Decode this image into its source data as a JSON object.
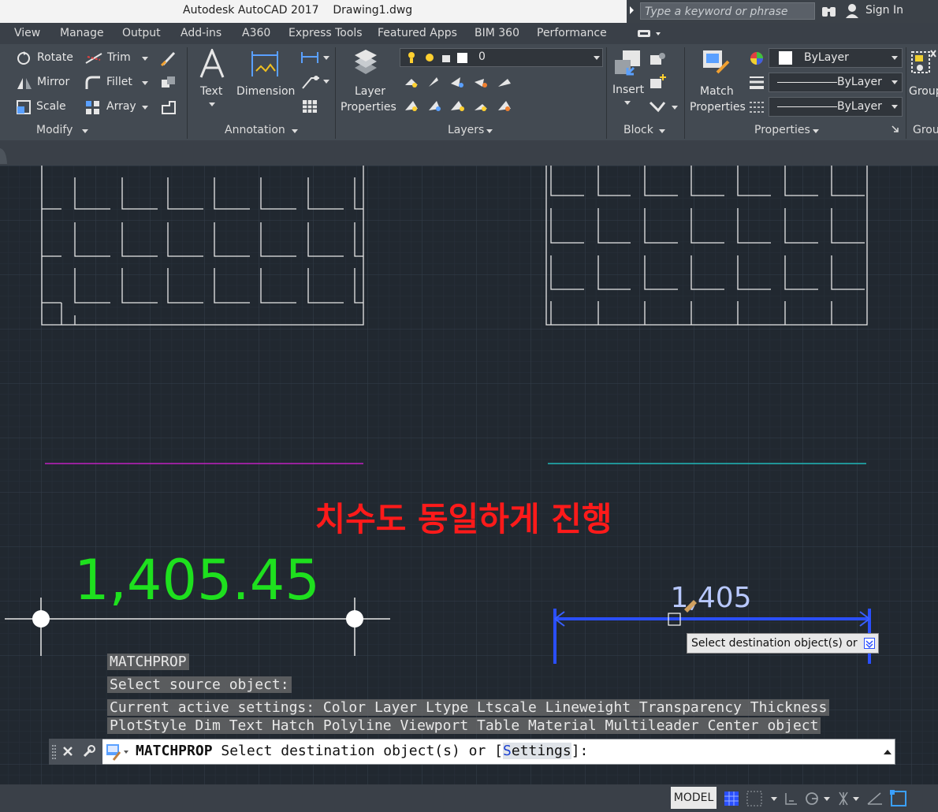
{
  "titlebar": {
    "title": "Autodesk AutoCAD 2017    Drawing1.dwg",
    "search_placeholder": "Type a keyword or phrase",
    "sign_in": "Sign In"
  },
  "menu_tabs": [
    "View",
    "Manage",
    "Output",
    "Add-ins",
    "A360",
    "Express Tools",
    "Featured Apps",
    "BIM 360",
    "Performance"
  ],
  "ribbon": {
    "modify": {
      "title": "Modify",
      "rotate": "Rotate",
      "mirror": "Mirror",
      "scale": "Scale",
      "trim": "Trim",
      "fillet": "Fillet",
      "array": "Array"
    },
    "annotation": {
      "title": "Annotation",
      "text": "Text",
      "dimension": "Dimension"
    },
    "layers": {
      "title": "Layers",
      "layer_properties_1": "Layer",
      "layer_properties_2": "Properties",
      "current_layer": "0"
    },
    "block": {
      "title": "Block",
      "insert": "Insert"
    },
    "properties": {
      "title": "Properties",
      "match_1": "Match",
      "match_2": "Properties",
      "color": "ByLayer",
      "linetype": "ByLayer",
      "lineweight": "ByLayer"
    },
    "groups": {
      "title": "Grou",
      "group": "Group"
    }
  },
  "canvas": {
    "annotation_korean": "치수도 동일하게 진행",
    "dim_left_value": "1,405.45",
    "dim_right_value": "1,405",
    "tooltip": "Select destination object(s) or",
    "colors": {
      "background": "#212830",
      "grid": "#2c3440",
      "magenta_line": "#c020c0",
      "cyan_line": "#20b8b8",
      "annotation_red": "#ff1a1a",
      "dim_green": "#1ee01e",
      "dim_blue": "#2a4fff"
    }
  },
  "command": {
    "history": [
      "MATCHPROP",
      "Select source object:",
      "Current active settings:  Color Layer Ltype Ltscale Lineweight Transparency Thickness",
      "PlotStyle Dim Text Hatch Polyline Viewport Table Material Multileader Center object"
    ],
    "prompt_cmd": "MATCHPROP",
    "prompt_text": " Select destination object(s) or [",
    "prompt_option": "Settings",
    "prompt_end": "]:"
  },
  "statusbar": {
    "model": "MODEL"
  }
}
